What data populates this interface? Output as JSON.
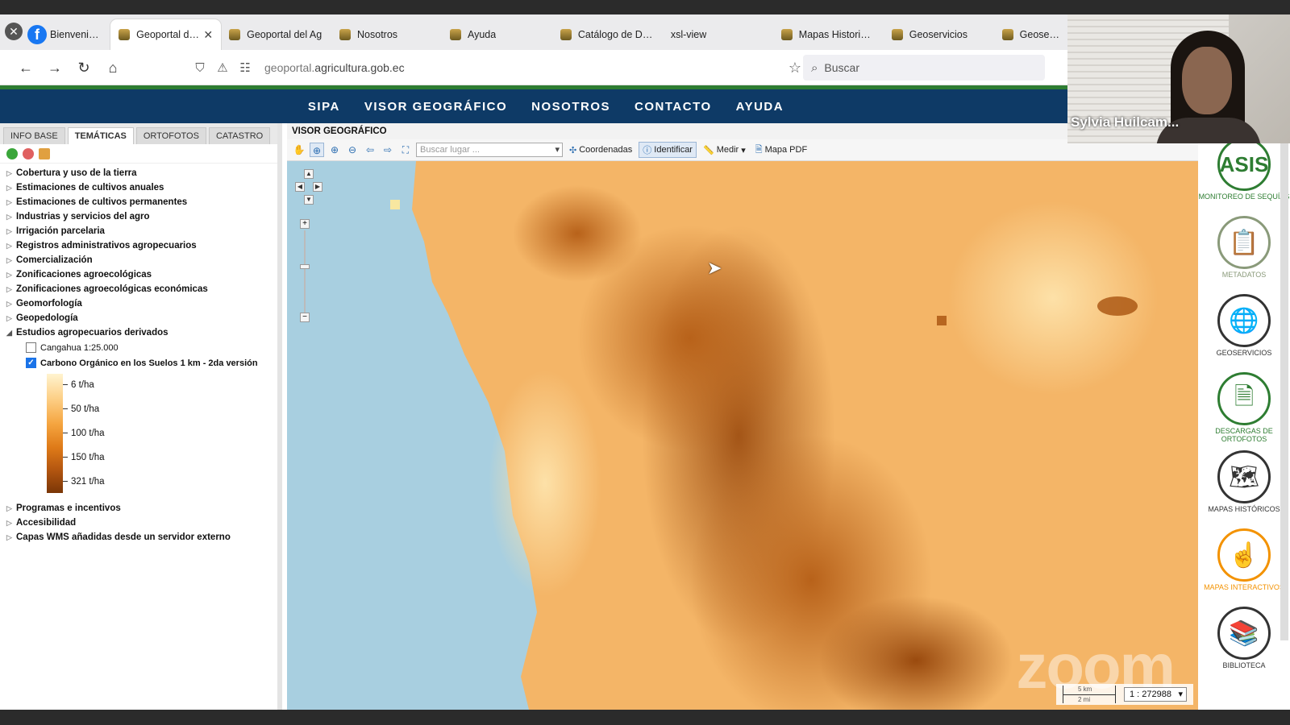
{
  "browser": {
    "tabs": [
      {
        "label": "Bienvenidos al Si",
        "active": false
      },
      {
        "label": "Geoportal del A",
        "active": true
      },
      {
        "label": "Geoportal del Ag",
        "active": false
      },
      {
        "label": "Nosotros",
        "active": false
      },
      {
        "label": "Ayuda",
        "active": false
      },
      {
        "label": "Catálogo de Dato",
        "active": false
      },
      {
        "label": "xsl-view",
        "active": false
      },
      {
        "label": "Mapas Historicos",
        "active": false
      },
      {
        "label": "Geoservicios",
        "active": false
      },
      {
        "label": "Geoservi",
        "active": false
      }
    ],
    "url_prefix": "geoportal.",
    "url_main": "agricultura.gob.ec",
    "search_placeholder": "Buscar"
  },
  "site_nav": [
    "SIPA",
    "VISOR GEOGRÁFICO",
    "NOSOTROS",
    "CONTACTO",
    "AYUDA"
  ],
  "left_panel": {
    "tabs": [
      "INFO BASE",
      "TEMÁTICAS",
      "ORTOFOTOS",
      "CATASTRO"
    ],
    "active_tab": "TEMÁTICAS",
    "tree_top": [
      "Cobertura y uso de la tierra",
      "Estimaciones de cultivos anuales",
      "Estimaciones de cultivos permanentes",
      "Industrias y servicios del agro",
      "Irrigación parcelaria",
      "Registros administrativos agropecuarios",
      "Comercialización",
      "Zonificaciones agroecológicas",
      "Zonificaciones agroecológicas económicas",
      "Geomorfología",
      "Geopedología"
    ],
    "expanded_group": "Estudios agropecuarios derivados",
    "layers": [
      {
        "label": "Cangahua 1:25.000",
        "checked": false
      },
      {
        "label": "Carbono Orgánico en los Suelos 1 km - 2da versión",
        "checked": true
      }
    ],
    "legend": [
      "6 t/ha",
      "50 t/ha",
      "100 t/ha",
      "150 t/ha",
      "321 t/ha"
    ],
    "tree_bottom": [
      "Programas e incentivos",
      "Accesibilidad",
      "Capas WMS añadidas desde un servidor externo"
    ]
  },
  "map": {
    "title": "VISOR GEOGRÁFICO",
    "search_placeholder": "Buscar lugar ...",
    "coords_label": "Coordenadas",
    "identify_label": "Identificar",
    "measure_label": "Medir",
    "pdf_label": "Mapa PDF",
    "scale_top": "5 km",
    "scale_bottom": "2 mi",
    "scale_value": "1 : 272988",
    "watermark": "zoom"
  },
  "right_icons": [
    {
      "label": "MONITOREO DE SEQUÍAS",
      "icon": "ASIS"
    },
    {
      "label": "METADATOS",
      "icon": "clipboard-icon"
    },
    {
      "label": "GEOSERVICIOS",
      "icon": "globe-icon"
    },
    {
      "label": "DESCARGAS DE ORTOFOTOS",
      "icon": "download-icon"
    },
    {
      "label": "MAPAS HISTÓRICOS",
      "icon": "map-icon"
    },
    {
      "label": "MAPAS INTERACTIVOS",
      "icon": "interactive-map-icon"
    },
    {
      "label": "BIBLIOTECA",
      "icon": "library-icon"
    }
  ],
  "webcam": {
    "name": "Sylvia Huilcam..."
  }
}
